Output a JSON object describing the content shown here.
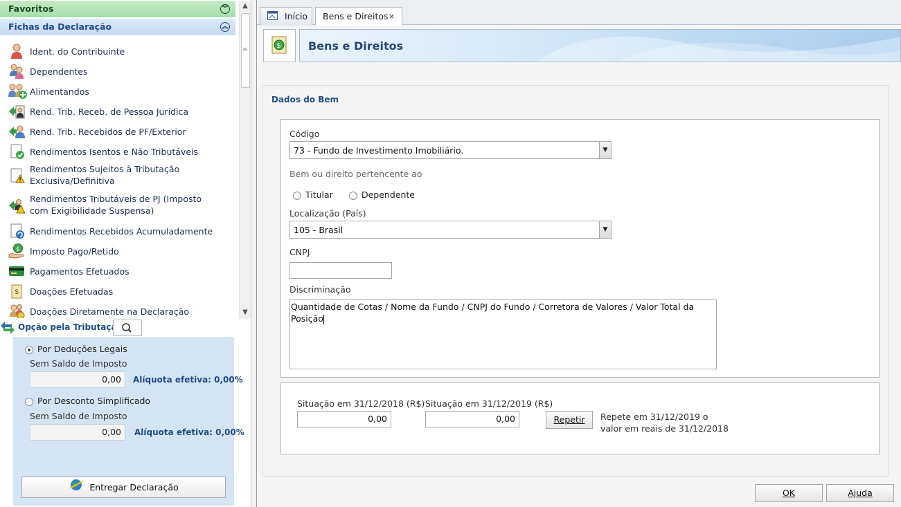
{
  "sidebar": {
    "favoritos": "Favoritos",
    "fichas_title": "Fichas da Declaração",
    "items": [
      {
        "label": "Ident. do Contribuinte",
        "icon": "person-icon"
      },
      {
        "label": "Dependentes",
        "icon": "family-icon"
      },
      {
        "label": "Alimentandos",
        "icon": "people-add-icon"
      },
      {
        "label": "Rend. Trib. Receb. de Pessoa Jurídica",
        "icon": "income-company-icon"
      },
      {
        "label": "Rend. Trib. Recebidos de PF/Exterior",
        "icon": "income-person-icon"
      },
      {
        "label": "Rendimentos Isentos e Não Tributáveis",
        "icon": "doc-check-icon"
      },
      {
        "label": "Rendimentos Sujeitos à Tributação Exclusiva/Definitiva",
        "icon": "doc-warning-icon"
      },
      {
        "label": "Rendimentos Tributáveis de PJ (Imposto com Exigibilidade Suspensa)",
        "icon": "income-warning-icon"
      },
      {
        "label": "Rendimentos Recebidos Acumuladamente",
        "icon": "doc-accumulated-icon"
      },
      {
        "label": "Imposto Pago/Retido",
        "icon": "hand-coin-icon"
      },
      {
        "label": "Pagamentos Efetuados",
        "icon": "card-icon"
      },
      {
        "label": "Doações Efetuadas",
        "icon": "money-bag-icon"
      },
      {
        "label": "Doações Diretamente na Declaração",
        "icon": "people-coin-icon"
      }
    ],
    "opcao": {
      "title": "Opção pela Tributação:",
      "deducoes_label": "Por Deduções Legais",
      "deducoes_sub": "Sem Saldo de Imposto",
      "deducoes_value": "0,00",
      "deducoes_aliq": "Alíquota efetiva: 0,00%",
      "simplificado_label": "Por Desconto Simplificado",
      "simplificado_sub": "Sem Saldo de Imposto",
      "simplificado_value": "0,00",
      "simplificado_aliq": "Alíquota efetiva: 0,00%",
      "selected": "deducoes"
    },
    "entregar_label": "Entregar Declaração"
  },
  "tabs": [
    {
      "label": "Início",
      "active": false
    },
    {
      "label": "Bens e Direitos",
      "active": true,
      "close": "×"
    }
  ],
  "page": {
    "title": "Bens e Direitos",
    "section_title": "Dados do Bem",
    "codigo_label": "Código",
    "codigo_value": "73 - Fundo de Investimento Imobiliário.",
    "pertence_label": "Bem ou direito pertencente ao",
    "titular_label": "Titular",
    "dependente_label": "Dependente",
    "localizacao_label": "Localização (País)",
    "localizacao_value": "105 - Brasil",
    "cnpj_label": "CNPJ",
    "cnpj_value": "",
    "discriminacao_label": "Discriminação",
    "discriminacao_value": "Quantidade de Cotas / Nome da Fundo / CNPJ do Fundo / Corretora de Valores / Valor Total da Posição",
    "sit2018_label": "Situação em 31/12/2018 (R$)",
    "sit2018_value": "0,00",
    "sit2019_label": "Situação em 31/12/2019 (R$)",
    "sit2019_value": "0,00",
    "repetir_label": "Repetir",
    "repete_note": "Repete em 31/12/2019 o valor em reais de 31/12/2018"
  },
  "footer": {
    "ok_label": "OK",
    "ajuda_label": "Ajuda"
  }
}
